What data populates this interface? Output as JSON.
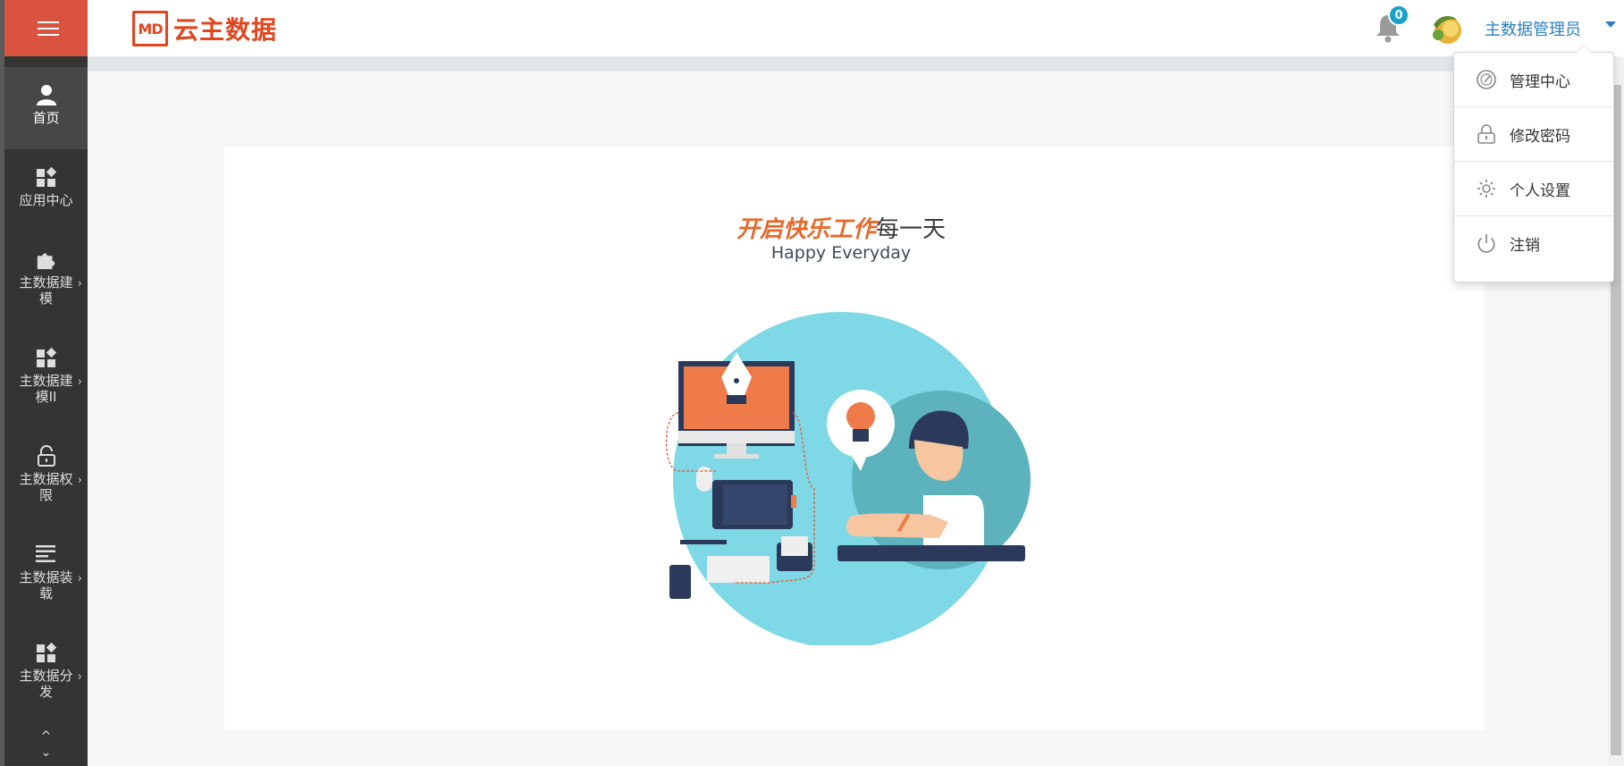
{
  "header": {
    "logo_badge": "MD",
    "logo_text": "云主数据",
    "notification_count": "0",
    "user_name": "主数据管理员"
  },
  "sidebar": {
    "items": [
      {
        "label": "首页",
        "icon": "user-icon",
        "active": true,
        "has_submenu": false
      },
      {
        "label": "应用中心",
        "icon": "apps-icon",
        "active": false,
        "has_submenu": false
      },
      {
        "label": "主数据建模",
        "icon": "puzzle-icon",
        "active": false,
        "has_submenu": true
      },
      {
        "label": "主数据建模II",
        "icon": "apps-icon",
        "active": false,
        "has_submenu": true
      },
      {
        "label": "主数据权限",
        "icon": "unlock-icon",
        "active": false,
        "has_submenu": true
      },
      {
        "label": "主数据装载",
        "icon": "list-icon",
        "active": false,
        "has_submenu": true
      },
      {
        "label": "主数据分发",
        "icon": "apps-icon",
        "active": false,
        "has_submenu": true
      }
    ],
    "scroll_up": "^",
    "scroll_down": "⌄"
  },
  "main": {
    "headline_orange": "开启快乐工作",
    "headline_dark": "每一天",
    "subline": "Happy Everyday"
  },
  "user_menu": {
    "items": [
      {
        "label": "管理中心",
        "icon": "dashboard-icon"
      },
      {
        "label": "修改密码",
        "icon": "lock-icon"
      },
      {
        "label": "个人设置",
        "icon": "gear-icon"
      },
      {
        "label": "注销",
        "icon": "power-icon"
      }
    ]
  },
  "colors": {
    "brand": "#e0461f",
    "sidebar_bg": "#343434",
    "toggle_bg": "#d9533f",
    "link": "#2a7fc4",
    "badge": "#1aa1c9"
  }
}
